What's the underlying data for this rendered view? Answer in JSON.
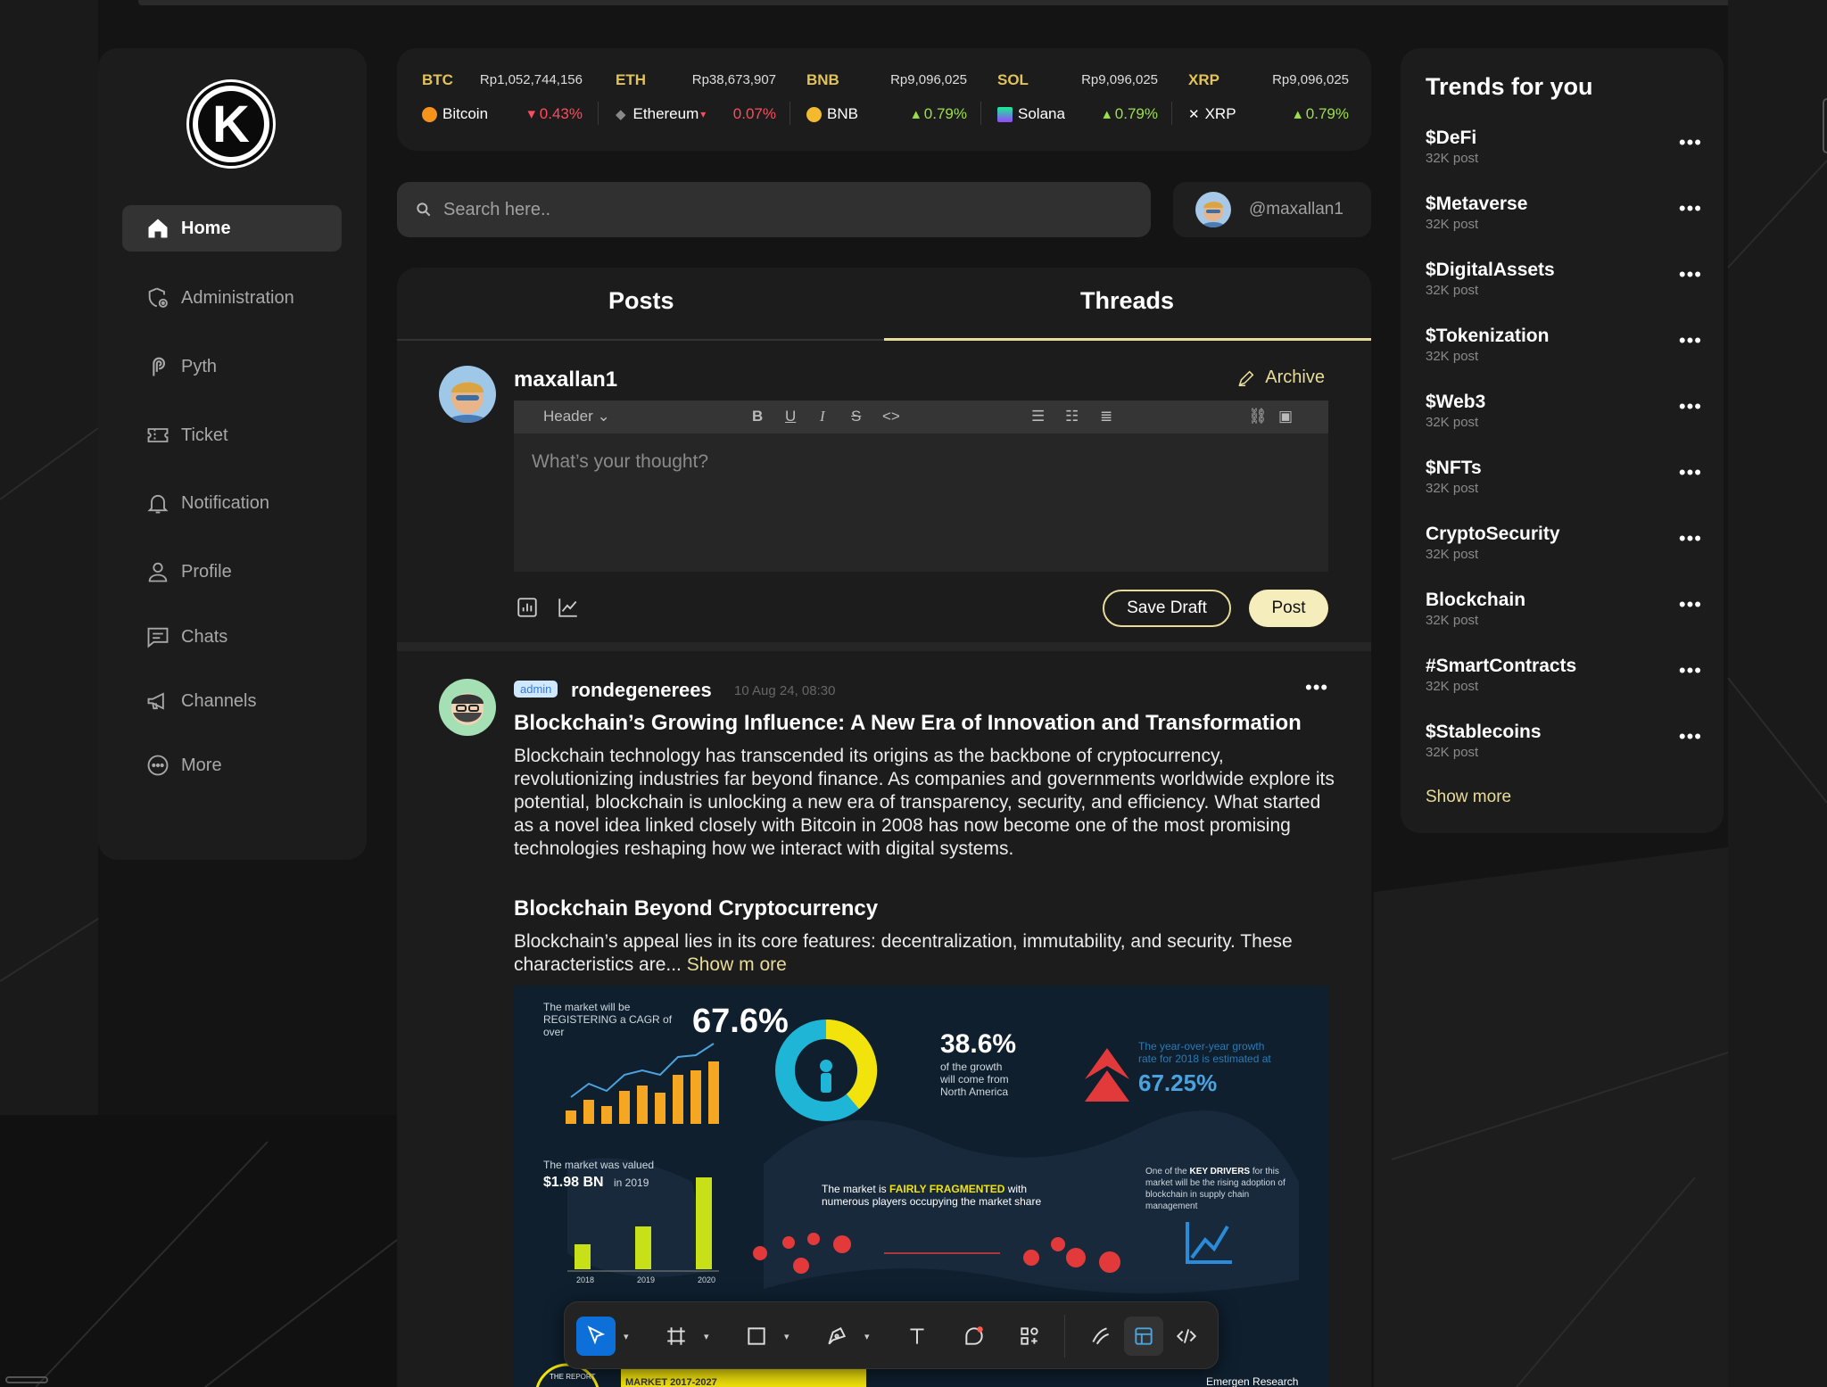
{
  "sidebar": {
    "logo_letter": "K",
    "items": [
      {
        "label": "Home",
        "icon": "home-icon",
        "active": true
      },
      {
        "label": "Administration",
        "icon": "shield-settings-icon"
      },
      {
        "label": "Pyth",
        "icon": "pyth-icon"
      },
      {
        "label": "Ticket",
        "icon": "ticket-icon"
      },
      {
        "label": "Notification",
        "icon": "bell-icon"
      },
      {
        "label": "Profile",
        "icon": "user-icon"
      },
      {
        "label": "Chats",
        "icon": "chat-icon"
      },
      {
        "label": "Channels",
        "icon": "megaphone-icon"
      },
      {
        "label": "More",
        "icon": "more-circle-icon"
      }
    ]
  },
  "ticker": [
    {
      "symbol": "BTC",
      "price": "Rp1,052,744,156",
      "name": "Bitcoin",
      "change": "0.43%",
      "direction": "down",
      "color": "#f7931a"
    },
    {
      "symbol": "ETH",
      "price": "Rp38,673,907",
      "name": "Ethereum",
      "change": "0.07%",
      "direction": "down",
      "color": "#8a8a8a"
    },
    {
      "symbol": "BNB",
      "price": "Rp9,096,025",
      "name": "BNB",
      "change": "0.79%",
      "direction": "up",
      "color": "#f3ba2f"
    },
    {
      "symbol": "SOL",
      "price": "Rp9,096,025",
      "name": "Solana",
      "change": "0.79%",
      "direction": "up",
      "color": "#9945ff"
    },
    {
      "symbol": "XRP",
      "price": "Rp9,096,025",
      "name": "XRP",
      "change": "0.79%",
      "direction": "up",
      "color": "#222222"
    }
  ],
  "search": {
    "placeholder": "Search here.."
  },
  "user": {
    "handle": "@maxallan1"
  },
  "tabs": [
    {
      "label": "Posts"
    },
    {
      "label": "Threads",
      "active": true
    }
  ],
  "composer": {
    "username": "maxallan1",
    "archive_label": "Archive",
    "header_select": "Header",
    "placeholder": "What’s your thought?",
    "save_draft_label": "Save Draft",
    "post_label": "Post"
  },
  "post": {
    "badge": "admin",
    "author": "rondegenerees",
    "date": "10 Aug 24, 08:30",
    "title": "Blockchain’s Growing Influence: A New Era of Innovation and Transformation",
    "body": "Blockchain technology has transcended its origins as the backbone of cryptocurrency, revolutionizing industries far beyond finance. As companies and governments worldwide explore its potential, blockchain is unlocking a new era of transparency, security, and efficiency. What started as a novel idea linked closely with Bitcoin in 2008 has now become one of the most promising technologies reshaping how we interact with digital systems.",
    "subtitle": "Blockchain Beyond Cryptocurrency",
    "body2": "Blockchain’s appeal lies in its core features: decentralization, immutability, and security. These characteristics are...",
    "show_more": "Show m ore",
    "infographic": {
      "cagr_text": "The market will be REGISTERING a CAGR of over",
      "cagr_value": "67.6%",
      "na_value": "38.6%",
      "na_text": "of the growth will come from North America",
      "yoy_text": "The year-over-year growth rate for 2018 is estimated at",
      "yoy_value": "67.25%",
      "valued_text": "The market was valued",
      "valued_value": "$1.98 BN",
      "valued_year": "in 2019",
      "years": [
        "2018",
        "2019",
        "2020"
      ],
      "fragmented_text": "The market is FAIRLY FRAGMENTED with numerous players occupying the market share",
      "drivers_text": "One of the KEY DRIVERS for this market will be the rising adoption of blockchain in supply chain management",
      "report_text": "THE REPORT",
      "market_text": "MARKET 2017-2027",
      "source_text": "Emergen Research"
    }
  },
  "trends": {
    "title": "Trends for you",
    "items": [
      {
        "name": "$DeFi",
        "count": "32K post"
      },
      {
        "name": "$Metaverse",
        "count": "32K post"
      },
      {
        "name": "$DigitalAssets",
        "count": "32K post"
      },
      {
        "name": "$Tokenization",
        "count": "32K post"
      },
      {
        "name": "$Web3",
        "count": "32K post"
      },
      {
        "name": "$NFTs",
        "count": "32K post"
      },
      {
        "name": "CryptoSecurity",
        "count": "32K post"
      },
      {
        "name": "Blockchain",
        "count": "32K post"
      },
      {
        "name": "#SmartContracts",
        "count": "32K post"
      },
      {
        "name": "$Stablecoins",
        "count": "32K post"
      }
    ],
    "show_more": "Show more"
  },
  "design_toolbar": {
    "tools": [
      "move-icon",
      "frame-icon",
      "rectangle-icon",
      "pen-icon",
      "text-icon",
      "comment-icon",
      "components-icon",
      "draw-icon",
      "dev-mode-icon",
      "code-icon"
    ]
  }
}
